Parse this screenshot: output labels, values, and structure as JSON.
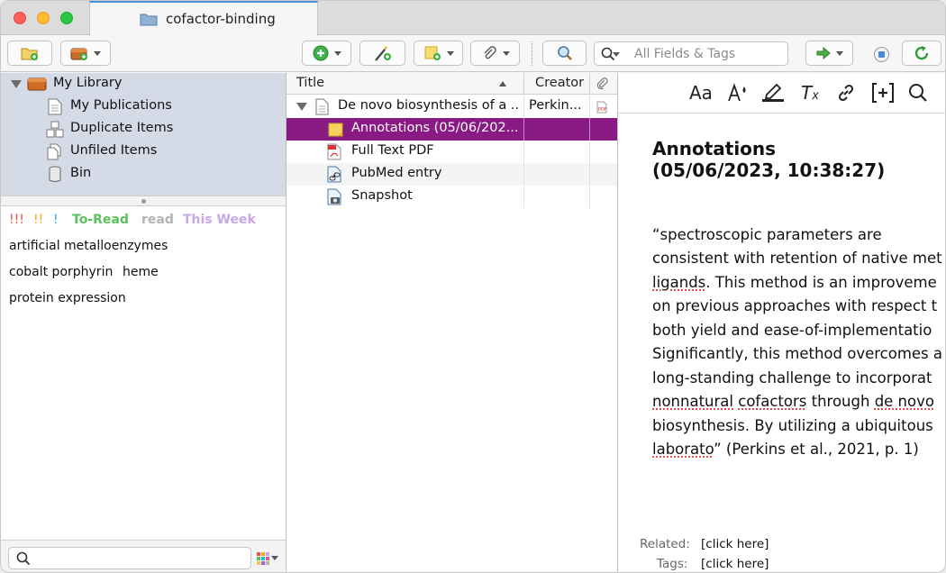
{
  "window": {
    "tab_title": "cofactor-binding"
  },
  "toolbar": {
    "search_placeholder": "All Fields & Tags",
    "icons": [
      "new-collection-icon",
      "new-library-icon",
      "new-item-icon",
      "magic-wand-icon",
      "new-note-icon",
      "attachment-icon",
      "locate-icon",
      "search-icon",
      "forward-arrow-icon",
      "sync-status-icon",
      "sync-icon"
    ]
  },
  "library": {
    "root": "My Library",
    "items": [
      "My Publications",
      "Duplicate Items",
      "Unfiled Items",
      "Bin"
    ]
  },
  "tags": {
    "colored": [
      {
        "label": "!!!",
        "color": "#e8523f"
      },
      {
        "label": "!!",
        "color": "#f5a623"
      },
      {
        "label": "!",
        "color": "#2fb3e0"
      },
      {
        "label": "To-Read",
        "color": "#5cc05c"
      },
      {
        "label": "read",
        "color": "#b3b3b3"
      },
      {
        "label": "This Week",
        "color": "#c8a8e8"
      }
    ],
    "plain": [
      "artificial metalloenzymes",
      "cobalt porphyrin",
      "heme",
      "protein expression"
    ]
  },
  "items_table": {
    "columns": [
      "Title",
      "Creator"
    ],
    "rows": [
      {
        "title": "De novo biosynthesis of a ...",
        "creator": "Perkin..."
      },
      {
        "title": "Annotations (05/06/202...",
        "creator": ""
      },
      {
        "title": "Full Text PDF",
        "creator": ""
      },
      {
        "title": "PubMed entry",
        "creator": ""
      },
      {
        "title": "Snapshot",
        "creator": ""
      }
    ]
  },
  "note": {
    "title_line1": "Annotations",
    "title_line2": "(05/06/2023, 10:38:27)",
    "body": [
      {
        "t": "“spectroscopic parameters are"
      },
      {
        "t": "consistent with retention of native met"
      },
      {
        "u": "ligands",
        "t": ". This method is an improveme"
      },
      {
        "t": "on previous approaches with respect t"
      },
      {
        "t": "both yield and ease-of-implementatio"
      },
      {
        "t": "Significantly, this method overcomes a"
      },
      {
        "t": "long-standing challenge to incorporat"
      },
      {
        "line": [
          "nonnatural",
          " ",
          "cofactors",
          " through ",
          "de novo"
        ]
      },
      {
        "t": "biosynthesis. By utilizing a ubiquitous"
      },
      {
        "u": "laborato",
        "t": "” (Perkins et al., 2021, p. 1)"
      }
    ],
    "related_label": "Related:",
    "related_value": "[click here]",
    "tags_label": "Tags:",
    "tags_value": "[click here]"
  },
  "accent": {
    "selection": "#8a1a83",
    "library_bg": "#d4dbe6"
  }
}
